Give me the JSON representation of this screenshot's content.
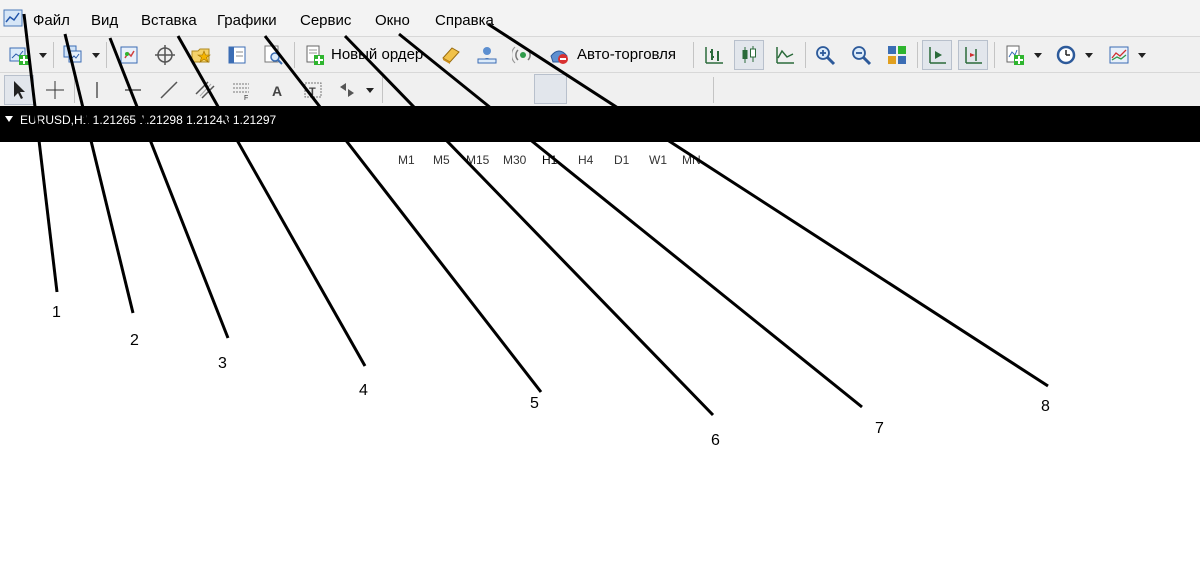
{
  "menu": {
    "items": [
      {
        "label": "Файл"
      },
      {
        "label": "Вид"
      },
      {
        "label": "Вставка"
      },
      {
        "label": "Графики"
      },
      {
        "label": "Сервис"
      },
      {
        "label": "Окно"
      },
      {
        "label": "Справка"
      }
    ]
  },
  "toolbar": {
    "new_order_label": "Новый ордер",
    "autotrade_label": "Авто-торговля"
  },
  "timeframes": [
    "M1",
    "M5",
    "M15",
    "M30",
    "H1",
    "H4",
    "D1",
    "W1",
    "MN"
  ],
  "selected_timeframe": "H1",
  "chart": {
    "title": "EURUSD,H1  1.21265 1.21298 1.21248 1.21297"
  },
  "callouts": [
    "1",
    "2",
    "3",
    "4",
    "5",
    "6",
    "7",
    "8"
  ]
}
